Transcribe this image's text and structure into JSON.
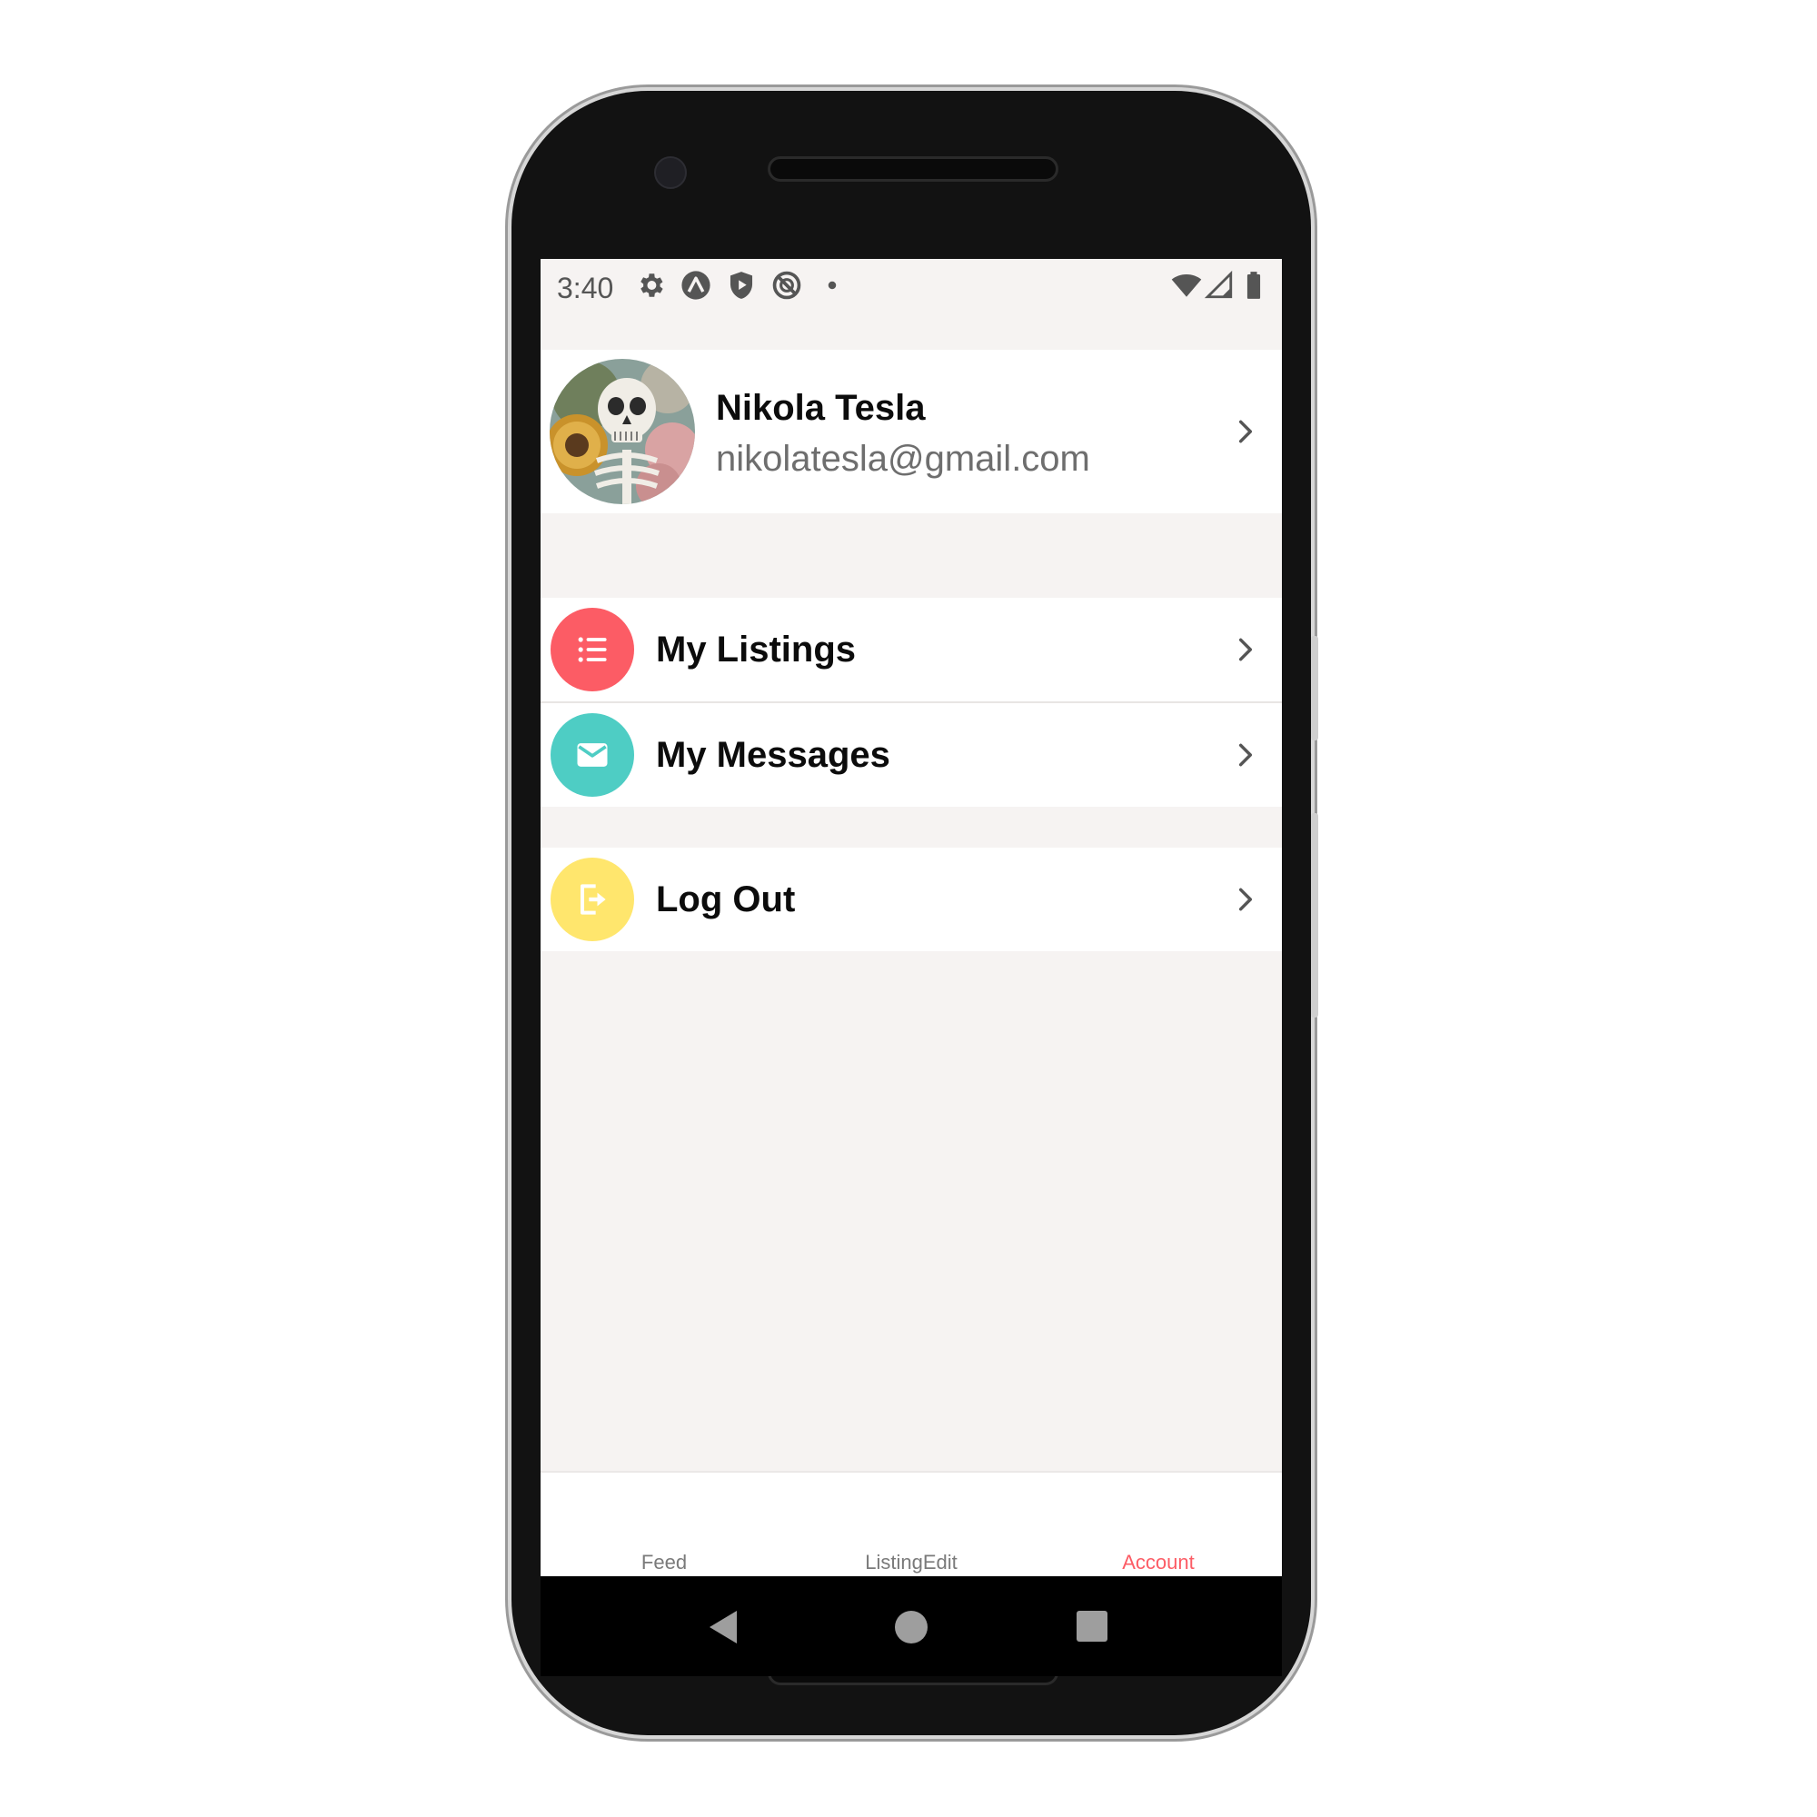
{
  "status_bar": {
    "time": "3:40",
    "left_icons": [
      "settings-icon",
      "expo-icon",
      "shield-play-icon",
      "no-disturb-icon",
      "dot-icon"
    ],
    "right_icons": [
      "wifi-icon",
      "signal-icon",
      "battery-icon"
    ]
  },
  "profile": {
    "name": "Nikola Tesla",
    "email": "nikolatesla@gmail.com"
  },
  "menu": {
    "listings": {
      "label": "My Listings",
      "color": "#fc5c65",
      "icon": "list-icon"
    },
    "messages": {
      "label": "My Messages",
      "color": "#4ecdc4",
      "icon": "email-icon"
    },
    "logout": {
      "label": "Log Out",
      "color": "#ffe66d",
      "icon": "logout-icon"
    }
  },
  "tabs": [
    {
      "label": "Feed",
      "active": false
    },
    {
      "label": "ListingEdit",
      "active": false
    },
    {
      "label": "Account",
      "active": true
    }
  ],
  "colors": {
    "background": "#f6f3f2",
    "accent": "#fc5c65"
  }
}
